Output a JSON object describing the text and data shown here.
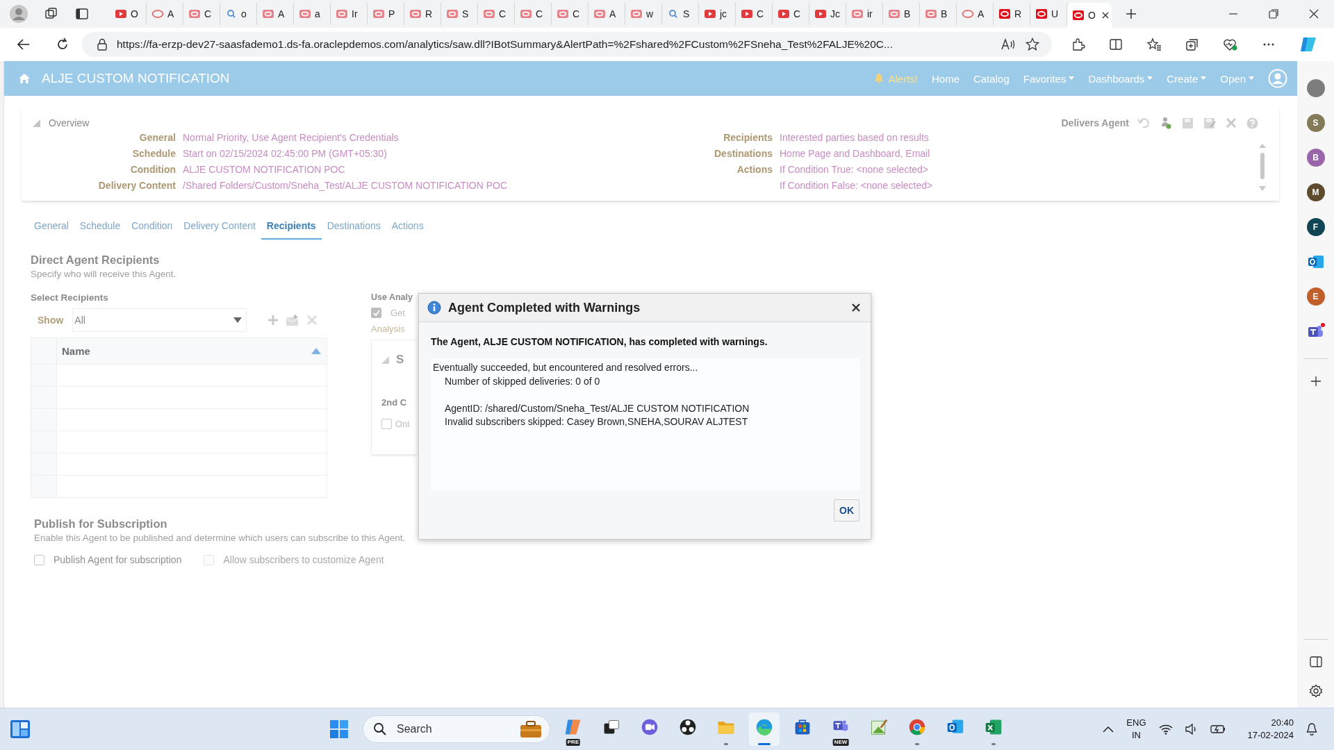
{
  "browser": {
    "tabs": [
      {
        "label": "O",
        "kind": "video",
        "selected": false
      },
      {
        "label": "A",
        "kind": "oval",
        "selected": false
      },
      {
        "label": "C",
        "kind": "page",
        "selected": false
      },
      {
        "label": "o",
        "kind": "search",
        "selected": false
      },
      {
        "label": "A",
        "kind": "page",
        "selected": false
      },
      {
        "label": "a",
        "kind": "page",
        "selected": false
      },
      {
        "label": "Ir",
        "kind": "page",
        "selected": false
      },
      {
        "label": "P",
        "kind": "page",
        "selected": false
      },
      {
        "label": "R",
        "kind": "page",
        "selected": false
      },
      {
        "label": "S",
        "kind": "page",
        "selected": false
      },
      {
        "label": "C",
        "kind": "page",
        "selected": false
      },
      {
        "label": "C",
        "kind": "page",
        "selected": false
      },
      {
        "label": "C",
        "kind": "page",
        "selected": false
      },
      {
        "label": "A",
        "kind": "page",
        "selected": false
      },
      {
        "label": "w",
        "kind": "page",
        "selected": false
      },
      {
        "label": "S",
        "kind": "search",
        "selected": false
      },
      {
        "label": "jc",
        "kind": "video",
        "selected": false
      },
      {
        "label": "C",
        "kind": "video",
        "selected": false
      },
      {
        "label": "C",
        "kind": "video",
        "selected": false
      },
      {
        "label": "Jc",
        "kind": "video",
        "selected": false
      },
      {
        "label": "ir",
        "kind": "page",
        "selected": false
      },
      {
        "label": "B",
        "kind": "page",
        "selected": false
      },
      {
        "label": "B",
        "kind": "page",
        "selected": false
      },
      {
        "label": "A",
        "kind": "oval",
        "selected": false
      },
      {
        "label": "R",
        "kind": "oracle",
        "selected": false
      },
      {
        "label": "U",
        "kind": "oracle",
        "selected": false
      },
      {
        "label": "O",
        "kind": "oracle",
        "selected": true
      }
    ],
    "url": "https://fa-erzp-dev27-saasfademo1.ds-fa.oraclepdemos.com/analytics/saw.dll?IBotSummary&AlertPath=%2Fshared%2FCustom%2FSneha_Test%2FALJE%20C..."
  },
  "app": {
    "title": "ALJE CUSTOM NOTIFICATION",
    "alert": "Alerts!",
    "nav": [
      {
        "label": "Home",
        "menu": false
      },
      {
        "label": "Catalog",
        "menu": false
      },
      {
        "label": "Favorites",
        "menu": true
      },
      {
        "label": "Dashboards",
        "menu": true
      },
      {
        "label": "Create",
        "menu": true
      },
      {
        "label": "Open",
        "menu": true
      }
    ]
  },
  "overview": {
    "title": "Overview",
    "owner": "Delivers Agent",
    "left": [
      {
        "label": "General",
        "value": "Normal Priority, Use Agent Recipient's Credentials"
      },
      {
        "label": "Schedule",
        "value": "Start on 02/15/2024 02:45:00 PM (GMT+05:30)"
      },
      {
        "label": "Condition",
        "value": "ALJE CUSTOM NOTIFICATION POC"
      },
      {
        "label": "Delivery Content",
        "value": "/Shared Folders/Custom/Sneha_Test/ALJE CUSTOM NOTIFICATION POC"
      }
    ],
    "right": [
      {
        "label": "Recipients",
        "value": "Interested parties based on results"
      },
      {
        "label": "Destinations",
        "value": "Home Page and Dashboard, Email"
      },
      {
        "label": "Actions",
        "value": "If Condition True: <none selected>"
      },
      {
        "value": "If Condition False: <none selected>"
      }
    ]
  },
  "tabs": [
    {
      "label": "General",
      "selected": false
    },
    {
      "label": "Schedule",
      "selected": false
    },
    {
      "label": "Condition",
      "selected": false
    },
    {
      "label": "Delivery Content",
      "selected": false
    },
    {
      "label": "Recipients",
      "selected": true
    },
    {
      "label": "Destinations",
      "selected": false
    },
    {
      "label": "Actions",
      "selected": false
    }
  ],
  "recipients": {
    "title": "Direct Agent Recipients",
    "subtitle": "Specify who will receive this Agent.",
    "select_title": "Select Recipients",
    "show_label": "Show",
    "show_value": "All",
    "table": {
      "columns": [
        "Name"
      ]
    }
  },
  "analysis": {
    "title": "Use Analy",
    "checkbox": {
      "label": "Get",
      "checked": true
    },
    "link": "Analysis",
    "panel_title": "S",
    "subtitle": "2nd C",
    "option": {
      "label": "Onl",
      "checked": false
    }
  },
  "publish": {
    "title": "Publish for Subscription",
    "description": "Enable this Agent to be published and determine which users can subscribe to this Agent.",
    "options": [
      {
        "label": "Publish Agent for subscription",
        "checked": false,
        "disabled": false
      },
      {
        "label": "Allow subscribers to customize Agent",
        "checked": false,
        "disabled": true
      }
    ]
  },
  "dialog": {
    "title": "Agent Completed with Warnings",
    "message": "The Agent, ALJE CUSTOM NOTIFICATION, has completed with warnings.",
    "details": [
      {
        "text": "Eventually succeeded, but encountered and resolved errors...",
        "indent": false,
        "gap_before": false
      },
      {
        "text": "Number of skipped deliveries: 0 of 0",
        "indent": true,
        "gap_before": false
      },
      {
        "text": "AgentID: /shared/Custom/Sneha_Test/ALJE CUSTOM NOTIFICATION",
        "indent": true,
        "gap_before": true
      },
      {
        "text": "Invalid subscribers skipped: Casey Brown,SNEHA,SOURAV ALJTEST",
        "indent": true,
        "gap_before": false
      }
    ],
    "button": "OK"
  },
  "sidebar": {
    "items": [
      {
        "kind": "avatar",
        "color": "#7d7d7d"
      },
      {
        "kind": "avatar",
        "letter": "S",
        "color": "#857a58"
      },
      {
        "kind": "avatar",
        "letter": "B",
        "color": "#9a66ab"
      },
      {
        "kind": "avatar",
        "letter": "M",
        "color": "#5e4a2c"
      },
      {
        "kind": "avatar",
        "letter": "F",
        "color": "#0f4555"
      },
      {
        "kind": "outlook"
      },
      {
        "kind": "avatar",
        "letter": "E",
        "color": "#c05f2a"
      },
      {
        "kind": "teams",
        "notification": true
      }
    ]
  },
  "taskbar": {
    "search_placeholder": "Search",
    "apps": [
      {
        "kind": "copilot",
        "badge": "PRE",
        "running": false,
        "selected": false
      },
      {
        "kind": "taskview",
        "running": false,
        "selected": false
      },
      {
        "kind": "meet",
        "running": false,
        "selected": false
      },
      {
        "kind": "obs",
        "running": false,
        "selected": false
      },
      {
        "kind": "explorer",
        "running": true,
        "selected": false
      },
      {
        "kind": "edge",
        "running": true,
        "selected": true
      },
      {
        "kind": "store",
        "running": false,
        "selected": false
      },
      {
        "kind": "teams",
        "badge": "NEW",
        "running": false,
        "selected": false
      },
      {
        "kind": "paint",
        "running": false,
        "selected": false
      },
      {
        "kind": "chrome",
        "running": true,
        "selected": false
      },
      {
        "kind": "outlook",
        "running": false,
        "selected": false
      },
      {
        "kind": "excel",
        "running": true,
        "selected": false
      }
    ],
    "language": "ENG",
    "region": "IN",
    "time": "20:40",
    "date": "17-02-2024"
  }
}
